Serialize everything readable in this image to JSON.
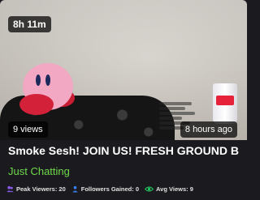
{
  "card": {
    "duration": "8h 11m",
    "views": "9 views",
    "time_ago": "8 hours ago",
    "title": "Smoke Sesh! JOIN US! FRESH GROUND B",
    "category": "Just Chatting",
    "category_color": "#6ed94a"
  },
  "stats": [
    {
      "icon": "peak-viewers-icon",
      "label": "Peak Viewers: 20",
      "color": "#8b5cf6"
    },
    {
      "icon": "followers-icon",
      "label": "Followers Gained: 0",
      "color": "#3b82f6"
    },
    {
      "icon": "eye-icon",
      "label": "Avg Views: 9",
      "color": "#22c55e"
    }
  ]
}
